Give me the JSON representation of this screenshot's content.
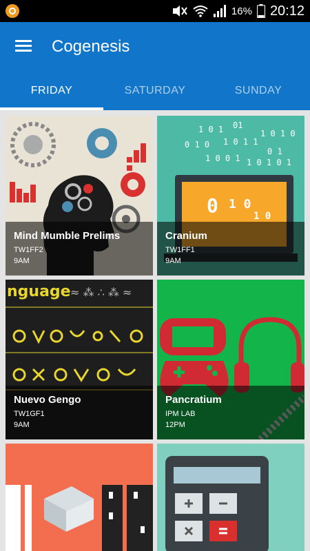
{
  "status_bar": {
    "battery_pct": "16%",
    "time": "20:12",
    "icons": [
      "notification-icon",
      "mute-icon",
      "wifi-icon",
      "signal-icon",
      "battery-icon"
    ]
  },
  "app": {
    "title": "Cogenesis",
    "menu_icon": "hamburger-menu-icon"
  },
  "tabs": [
    {
      "label": "FRIDAY",
      "active": true
    },
    {
      "label": "SATURDAY",
      "active": false
    },
    {
      "label": "SUNDAY",
      "active": false
    }
  ],
  "events": [
    {
      "title": "Mind Mumble Prelims",
      "room": "TW1FF2",
      "time": "9AM",
      "art": "brain-gears-illustration"
    },
    {
      "title": "Cranium",
      "room": "TW1FF1",
      "time": "9AM",
      "art": "laptop-binary-illustration"
    },
    {
      "title": "Nuevo Gengo",
      "room": "TW1GF1",
      "time": "9AM",
      "art": "language-glyphs-illustration"
    },
    {
      "title": "Pancratium",
      "room": "IPM LAB",
      "time": "12PM",
      "art": "gamepad-headphones-illustration"
    },
    {
      "title": "",
      "room": "",
      "time": "",
      "art": "puzzle-box-illustration"
    },
    {
      "title": "",
      "room": "",
      "time": "",
      "art": "calculator-illustration"
    }
  ],
  "artwork_text": {
    "nuevo_gengo_word": "nguage"
  },
  "colors": {
    "app_bar": "#1176c9",
    "status_bar": "#000000",
    "background": "#e4e4e4"
  }
}
